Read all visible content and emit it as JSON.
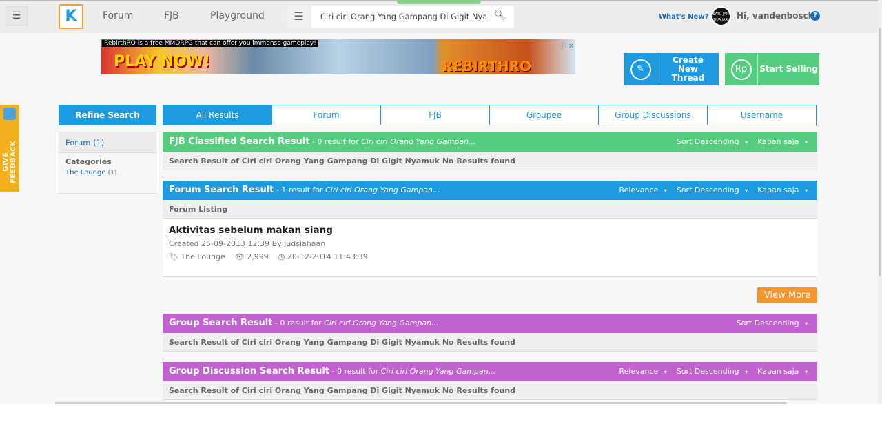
{
  "nav": {
    "menu_icon": "hamburger-icon",
    "logo": "K",
    "links": [
      "Forum",
      "FJB",
      "Playground"
    ],
    "search_value": "Ciri ciri Orang Yang Gampang Di Gigit Nyamuk",
    "whats_new": "What's New?",
    "avatar_text": "SATU JARI DUA JARI",
    "greeting": "Hi, vandenbosch",
    "help": "?"
  },
  "ad": {
    "caption": "RebirthRO is a free MMORPG that can offer you immense gameplay!",
    "play": "PLAY NOW!",
    "brand": "REBIRTHRO",
    "close": "ⓘ ✕"
  },
  "actions": {
    "create": "Create New Thread",
    "sell": "Start Selling",
    "sell_icon": "Rp",
    "pencil_icon": "✎"
  },
  "feedback": "GIVE FEEDBACK",
  "sidebar": {
    "refine": "Refine Search",
    "forum": "Forum (1)",
    "categories": "Categories",
    "lounge": "The Lounge",
    "lounge_count": "(1)"
  },
  "tabs": [
    "All Results",
    "Forum",
    "FJB",
    "Groupee",
    "Group Discussions",
    "Username"
  ],
  "colors": {
    "blue": "#1e9ae0",
    "green": "#56cc7e",
    "purple": "#c162d0",
    "orange": "#f5952f"
  },
  "sections": {
    "fjb": {
      "title": "FJB Classified Search Result",
      "count": " - 0 result for ",
      "query": "Ciri ciri Orang Yang Gampan...",
      "controls": [
        "Sort Descending",
        "Kapan saja"
      ],
      "sub": "Search Result of Ciri ciri Orang Yang Gampang Di Gigit Nyamuk No Results found"
    },
    "forum": {
      "title": "Forum Search Result",
      "count": " - 1 result for ",
      "query": "Ciri ciri Orang Yang Gampan...",
      "controls": [
        "Relevance",
        "Sort Descending",
        "Kapan saja"
      ],
      "sub": "Forum Listing",
      "item": {
        "title": "Aktivitas sebelum makan siang",
        "created": "Created 25-09-2013 12:39 By judsiahaan",
        "category": "The Lounge",
        "views": "2,999",
        "last": "20-12-2014 11:43:39"
      },
      "view_more": "View More"
    },
    "group": {
      "title": "Group Search Result",
      "count": " - 0 result for ",
      "query": "Ciri ciri Orang Yang Gampan...",
      "controls": [
        "Sort Descending"
      ],
      "sub": "Search Result of Ciri ciri Orang Yang Gampang Di Gigit Nyamuk No Results found"
    },
    "gd": {
      "title": "Group Discussion Search Result",
      "count": " - 0 result for ",
      "query": "Ciri ciri Orang Yang Gampan...",
      "controls": [
        "Relevance",
        "Sort Descending",
        "Kapan saja"
      ],
      "sub": "Search Result of Ciri ciri Orang Yang Gampang Di Gigit Nyamuk No Results found"
    }
  }
}
